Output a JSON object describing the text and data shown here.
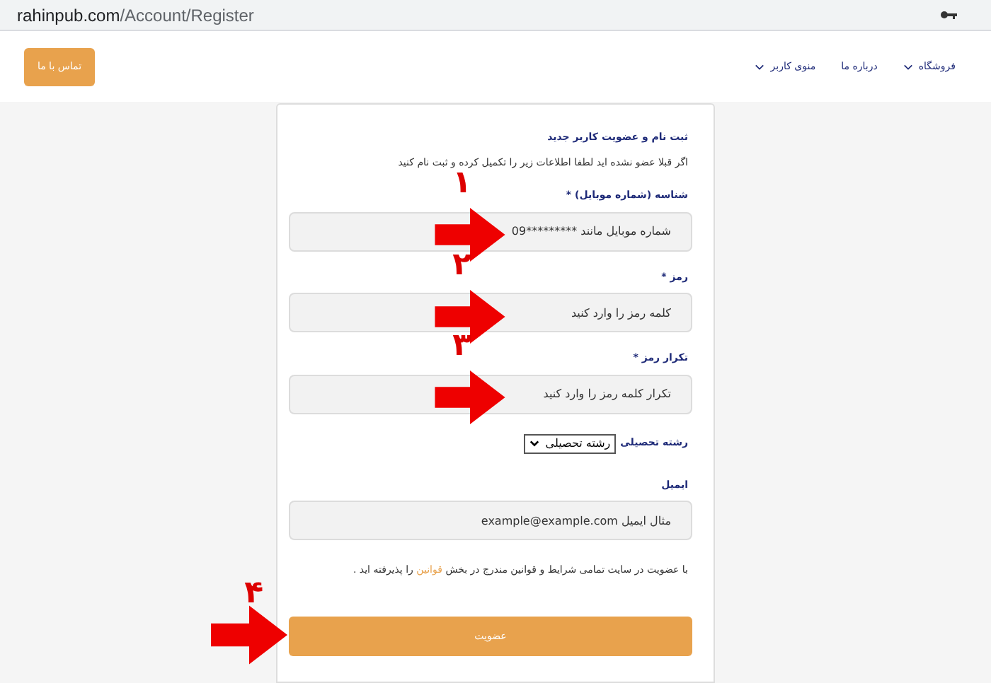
{
  "browser": {
    "url_host": "rahinpub.com",
    "url_path": "/Account/Register"
  },
  "header": {
    "contact_button": "تماس با ما",
    "nav": [
      {
        "label": "فروشگاه",
        "has_menu": true
      },
      {
        "label": "درباره ما",
        "has_menu": false
      },
      {
        "label": "منوی کاربر",
        "has_menu": true
      }
    ]
  },
  "form": {
    "title": "ثبت نام و عضویت کاربر جدید",
    "subtitle": "اگر قبلا عضو نشده اید لطفا اطلاعات زیر را تکمیل کرده و ثبت نام کنید",
    "fields": [
      {
        "kind": "text",
        "label": "شناسه (شماره موبایل) *",
        "placeholder": "شماره موبایل مانند *********09",
        "marker": "۱"
      },
      {
        "kind": "text",
        "label": "رمز *",
        "placeholder": "کلمه رمز را وارد کنید",
        "marker": "۲"
      },
      {
        "kind": "text",
        "label": "تکرار رمز *",
        "placeholder": "تکرار کلمه رمز را وارد کنید",
        "marker": "۳"
      },
      {
        "kind": "select",
        "label": "رشته تحصیلی",
        "value": "رشته تحصیلی"
      },
      {
        "kind": "text",
        "label": "ایمیل",
        "placeholder": "مثال ایمیل example@example.com"
      }
    ],
    "terms": {
      "before": "با عضویت در سایت تمامی شرایط و قوانین مندرج در بخش",
      "link": "قوانین",
      "after": "را پذیرفته اید ."
    },
    "submit": {
      "label": "عضویت",
      "marker": "۴"
    }
  }
}
